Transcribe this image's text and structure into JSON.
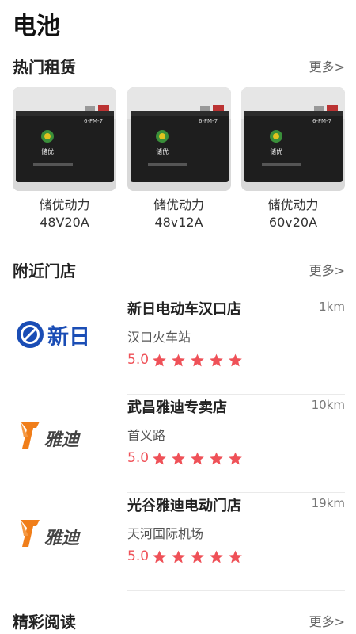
{
  "page": {
    "title": "电池"
  },
  "hot_rentals": {
    "title": "热门租赁",
    "more": "更多>",
    "products": [
      {
        "name": "储优动力",
        "spec": "48V20A",
        "image_label": "6-FM-7",
        "brand_mark": "储优"
      },
      {
        "name": "储优动力",
        "spec": "48v12A",
        "image_label": "6-FM-7",
        "brand_mark": "储优"
      },
      {
        "name": "储优动力",
        "spec": "60v20A",
        "image_label": "6-FM-7",
        "brand_mark": "储优"
      }
    ]
  },
  "nearby_stores": {
    "title": "附近门店",
    "more": "更多>",
    "stores": [
      {
        "name": "新日电动车汉口店",
        "distance": "1km",
        "address": "汉口火车站",
        "rating": "5.0",
        "stars": 5,
        "logo_text": "新日"
      },
      {
        "name": "武昌雅迪专卖店",
        "distance": "10km",
        "address": "首义路",
        "rating": "5.0",
        "stars": 5,
        "logo_text": "雅迪"
      },
      {
        "name": "光谷雅迪电动门店",
        "distance": "19km",
        "address": "天河国际机场",
        "rating": "5.0",
        "stars": 5,
        "logo_text": "雅迪"
      }
    ]
  },
  "featured_reading": {
    "title": "精彩阅读",
    "more": "更多>"
  },
  "colors": {
    "accent_red": "#ef5158",
    "sunrise_blue": "#1a4db5",
    "yadea_orange": "#f07e1a"
  },
  "icons": {
    "star": "star-icon"
  }
}
